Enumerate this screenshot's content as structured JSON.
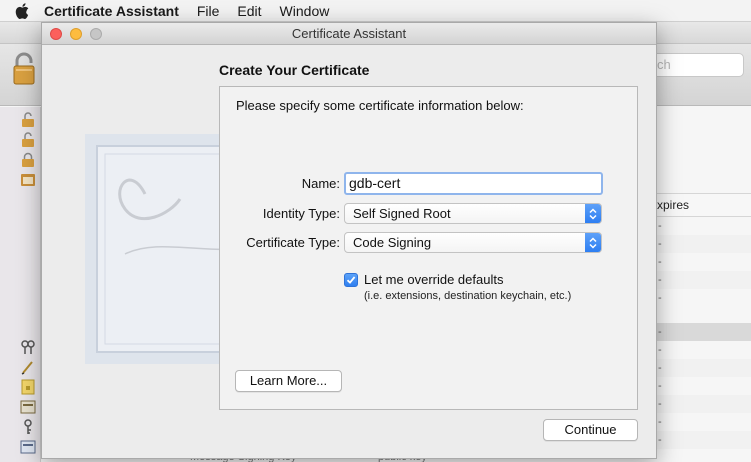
{
  "menubar": {
    "app_name": "Certificate Assistant",
    "items": [
      "File",
      "Edit",
      "Window"
    ]
  },
  "background_window": {
    "search_placeholder": "ch",
    "table_header": "xpires",
    "row_marks": [
      "-",
      "-",
      "-",
      "-",
      "-",
      "-",
      "-",
      "-",
      "-",
      "-",
      "-",
      "-"
    ],
    "bottom_left_text": "Message Signing Key",
    "bottom_right_text": "public key"
  },
  "dialog": {
    "title": "Certificate Assistant",
    "heading": "Create Your Certificate",
    "instructions": "Please specify some certificate information below:",
    "fields": {
      "name_label": "Name:",
      "name_value": "gdb-cert",
      "identity_label": "Identity Type:",
      "identity_value": "Self Signed Root",
      "cert_type_label": "Certificate Type:",
      "cert_type_value": "Code Signing"
    },
    "override": {
      "label": "Let me override defaults",
      "hint": "(i.e. extensions, destination keychain, etc.)",
      "checked": true
    },
    "learn_more": "Learn More...",
    "continue": "Continue"
  },
  "colors": {
    "accent": "#2f7ff0",
    "close": "#fc605c",
    "minimize": "#fdbc40",
    "zoom": "#c6c6c6"
  }
}
